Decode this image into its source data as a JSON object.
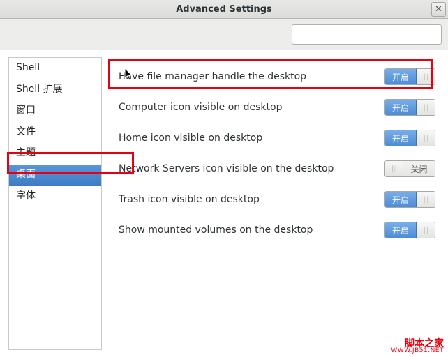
{
  "window": {
    "title": "Advanced Settings"
  },
  "search": {
    "placeholder": ""
  },
  "toggle_labels": {
    "on": "开启",
    "off": "关闭"
  },
  "sidebar": {
    "items": [
      {
        "label": "Shell",
        "selected": false
      },
      {
        "label": "Shell 扩展",
        "selected": false
      },
      {
        "label": "窗口",
        "selected": false
      },
      {
        "label": "文件",
        "selected": false
      },
      {
        "label": "主题",
        "selected": false
      },
      {
        "label": "桌面",
        "selected": true
      },
      {
        "label": "字体",
        "selected": false
      }
    ]
  },
  "settings": [
    {
      "label": "Have file manager handle the desktop",
      "state": "on"
    },
    {
      "label": "Computer icon visible on desktop",
      "state": "on"
    },
    {
      "label": "Home icon visible on desktop",
      "state": "on"
    },
    {
      "label": "Network Servers icon visible on the desktop",
      "state": "off"
    },
    {
      "label": "Trash icon visible on desktop",
      "state": "on"
    },
    {
      "label": "Show mounted volumes on the desktop",
      "state": "on"
    }
  ],
  "watermark": {
    "line1": "脚本之家",
    "line2": "WWW.JB51.NET"
  }
}
